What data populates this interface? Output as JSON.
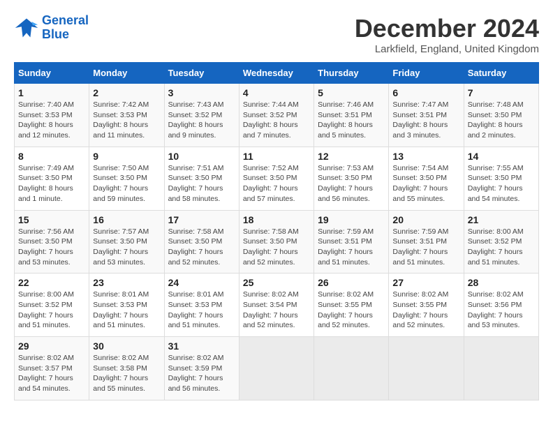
{
  "header": {
    "logo_line1": "General",
    "logo_line2": "Blue",
    "month_title": "December 2024",
    "location": "Larkfield, England, United Kingdom"
  },
  "days_of_week": [
    "Sunday",
    "Monday",
    "Tuesday",
    "Wednesday",
    "Thursday",
    "Friday",
    "Saturday"
  ],
  "weeks": [
    [
      {
        "day": "1",
        "sunrise": "7:40 AM",
        "sunset": "3:53 PM",
        "daylight": "8 hours and 12 minutes."
      },
      {
        "day": "2",
        "sunrise": "7:42 AM",
        "sunset": "3:53 PM",
        "daylight": "8 hours and 11 minutes."
      },
      {
        "day": "3",
        "sunrise": "7:43 AM",
        "sunset": "3:52 PM",
        "daylight": "8 hours and 9 minutes."
      },
      {
        "day": "4",
        "sunrise": "7:44 AM",
        "sunset": "3:52 PM",
        "daylight": "8 hours and 7 minutes."
      },
      {
        "day": "5",
        "sunrise": "7:46 AM",
        "sunset": "3:51 PM",
        "daylight": "8 hours and 5 minutes."
      },
      {
        "day": "6",
        "sunrise": "7:47 AM",
        "sunset": "3:51 PM",
        "daylight": "8 hours and 3 minutes."
      },
      {
        "day": "7",
        "sunrise": "7:48 AM",
        "sunset": "3:50 PM",
        "daylight": "8 hours and 2 minutes."
      }
    ],
    [
      {
        "day": "8",
        "sunrise": "7:49 AM",
        "sunset": "3:50 PM",
        "daylight": "8 hours and 1 minute."
      },
      {
        "day": "9",
        "sunrise": "7:50 AM",
        "sunset": "3:50 PM",
        "daylight": "7 hours and 59 minutes."
      },
      {
        "day": "10",
        "sunrise": "7:51 AM",
        "sunset": "3:50 PM",
        "daylight": "7 hours and 58 minutes."
      },
      {
        "day": "11",
        "sunrise": "7:52 AM",
        "sunset": "3:50 PM",
        "daylight": "7 hours and 57 minutes."
      },
      {
        "day": "12",
        "sunrise": "7:53 AM",
        "sunset": "3:50 PM",
        "daylight": "7 hours and 56 minutes."
      },
      {
        "day": "13",
        "sunrise": "7:54 AM",
        "sunset": "3:50 PM",
        "daylight": "7 hours and 55 minutes."
      },
      {
        "day": "14",
        "sunrise": "7:55 AM",
        "sunset": "3:50 PM",
        "daylight": "7 hours and 54 minutes."
      }
    ],
    [
      {
        "day": "15",
        "sunrise": "7:56 AM",
        "sunset": "3:50 PM",
        "daylight": "7 hours and 53 minutes."
      },
      {
        "day": "16",
        "sunrise": "7:57 AM",
        "sunset": "3:50 PM",
        "daylight": "7 hours and 53 minutes."
      },
      {
        "day": "17",
        "sunrise": "7:58 AM",
        "sunset": "3:50 PM",
        "daylight": "7 hours and 52 minutes."
      },
      {
        "day": "18",
        "sunrise": "7:58 AM",
        "sunset": "3:50 PM",
        "daylight": "7 hours and 52 minutes."
      },
      {
        "day": "19",
        "sunrise": "7:59 AM",
        "sunset": "3:51 PM",
        "daylight": "7 hours and 51 minutes."
      },
      {
        "day": "20",
        "sunrise": "7:59 AM",
        "sunset": "3:51 PM",
        "daylight": "7 hours and 51 minutes."
      },
      {
        "day": "21",
        "sunrise": "8:00 AM",
        "sunset": "3:52 PM",
        "daylight": "7 hours and 51 minutes."
      }
    ],
    [
      {
        "day": "22",
        "sunrise": "8:00 AM",
        "sunset": "3:52 PM",
        "daylight": "7 hours and 51 minutes."
      },
      {
        "day": "23",
        "sunrise": "8:01 AM",
        "sunset": "3:53 PM",
        "daylight": "7 hours and 51 minutes."
      },
      {
        "day": "24",
        "sunrise": "8:01 AM",
        "sunset": "3:53 PM",
        "daylight": "7 hours and 51 minutes."
      },
      {
        "day": "25",
        "sunrise": "8:02 AM",
        "sunset": "3:54 PM",
        "daylight": "7 hours and 52 minutes."
      },
      {
        "day": "26",
        "sunrise": "8:02 AM",
        "sunset": "3:55 PM",
        "daylight": "7 hours and 52 minutes."
      },
      {
        "day": "27",
        "sunrise": "8:02 AM",
        "sunset": "3:55 PM",
        "daylight": "7 hours and 52 minutes."
      },
      {
        "day": "28",
        "sunrise": "8:02 AM",
        "sunset": "3:56 PM",
        "daylight": "7 hours and 53 minutes."
      }
    ],
    [
      {
        "day": "29",
        "sunrise": "8:02 AM",
        "sunset": "3:57 PM",
        "daylight": "7 hours and 54 minutes."
      },
      {
        "day": "30",
        "sunrise": "8:02 AM",
        "sunset": "3:58 PM",
        "daylight": "7 hours and 55 minutes."
      },
      {
        "day": "31",
        "sunrise": "8:02 AM",
        "sunset": "3:59 PM",
        "daylight": "7 hours and 56 minutes."
      },
      null,
      null,
      null,
      null
    ]
  ],
  "labels": {
    "sunrise": "Sunrise:",
    "sunset": "Sunset:",
    "daylight": "Daylight:"
  }
}
